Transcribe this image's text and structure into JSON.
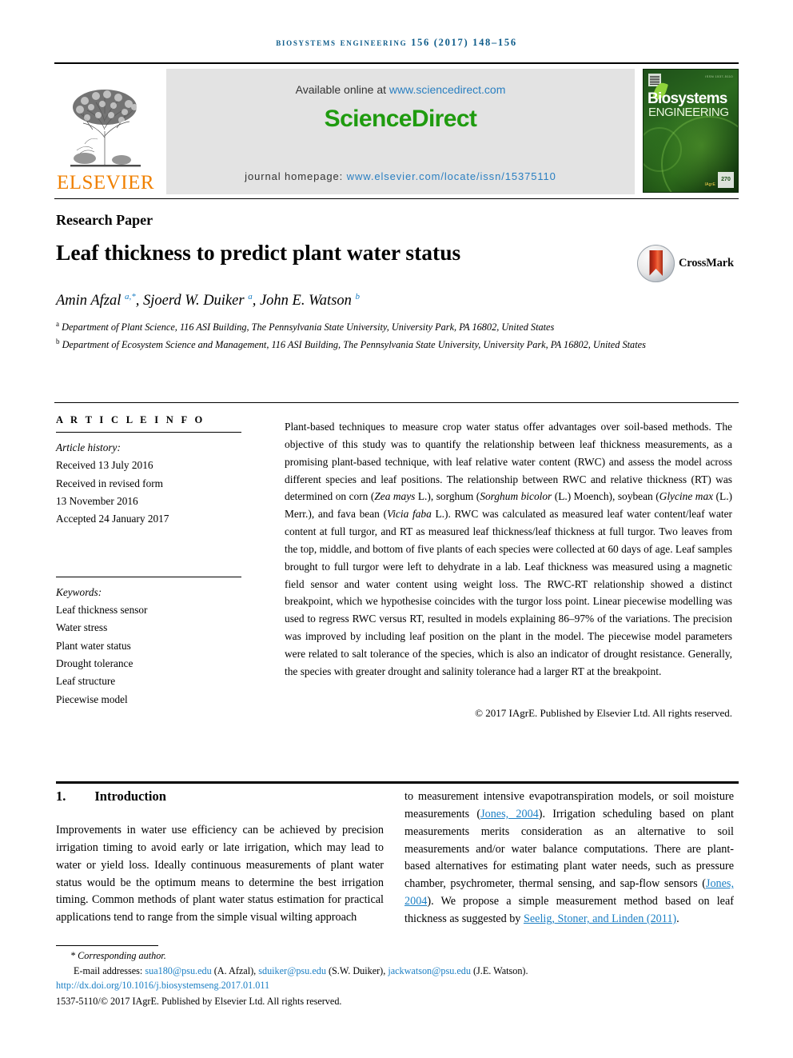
{
  "running_head": "Biosystems Engineering 156 (2017) 148–156",
  "masthead": {
    "elsevier_wordmark": "ELSEVIER",
    "available_prefix": "Available online at ",
    "available_url": "www.sciencedirect.com",
    "sciencedirect_logo": "ScienceDirect",
    "homepage_prefix": "journal homepage: ",
    "homepage_url": "www.elsevier.com/locate/issn/15375110",
    "cover": {
      "title_line1": "Biosystems",
      "title_line2": "ENGINEERING",
      "top_text": "ISSN 1537-5110",
      "badge": "270",
      "badge_sub": "IAgrE"
    },
    "colors": {
      "elsevier_orange": "#F08000",
      "sciencedirect_green": "#1f9b0f",
      "link_blue": "#2a7fc1",
      "banner_grey": "#e3e3e3",
      "cover_green": "#1d4f19"
    }
  },
  "article": {
    "type": "Research Paper",
    "title": "Leaf thickness to predict plant water status",
    "crossmark_label": "CrossMark",
    "authors_html": "Amin Afzal <sup>a,*</sup>, Sjoerd W. Duiker <sup>a</sup>, John E. Watson <sup>b</sup>",
    "affiliations": [
      "a Department of Plant Science, 116 ASI Building, The Pennsylvania State University, University Park, PA 16802, United States",
      "b Department of Ecosystem Science and Management, 116 ASI Building, The Pennsylvania State University, University Park, PA 16802, United States"
    ]
  },
  "article_info": {
    "heading": "A R T I C L E   I N F O",
    "history_label": "Article history:",
    "history": [
      "Received 13 July 2016",
      "Received in revised form",
      "13 November 2016",
      "Accepted 24 January 2017"
    ],
    "keywords_label": "Keywords:",
    "keywords": [
      "Leaf thickness sensor",
      "Water stress",
      "Plant water status",
      "Drought tolerance",
      "Leaf structure",
      "Piecewise model"
    ]
  },
  "abstract": {
    "text": "Plant-based techniques to measure crop water status offer advantages over soil-based methods. The objective of this study was to quantify the relationship between leaf thickness measurements, as a promising plant-based technique, with leaf relative water content (RWC) and assess the model across different species and leaf positions. The relationship between RWC and relative thickness (RT) was determined on corn (Zea mays L.), sorghum (Sorghum bicolor (L.) Moench), soybean (Glycine max (L.) Merr.), and fava bean (Vicia faba L.). RWC was calculated as measured leaf water content/leaf water content at full turgor, and RT as measured leaf thickness/leaf thickness at full turgor. Two leaves from the top, middle, and bottom of five plants of each species were collected at 60 days of age. Leaf samples brought to full turgor were left to dehydrate in a lab. Leaf thickness was measured using a magnetic field sensor and water content using weight loss. The RWC-RT relationship showed a distinct breakpoint, which we hypothesise coincides with the turgor loss point. Linear piecewise modelling was used to regress RWC versus RT, resulted in models explaining 86–97% of the variations. The precision was improved by including leaf position on the plant in the model. The piecewise model parameters were related to salt tolerance of the species, which is also an indicator of drought resistance. Generally, the species with greater drought and salinity tolerance had a larger RT at the breakpoint.",
    "copyright": "© 2017 IAgrE. Published by Elsevier Ltd. All rights reserved."
  },
  "body": {
    "section_number": "1.",
    "section_title": "Introduction",
    "left_paragraph": "Improvements in water use efficiency can be achieved by precision irrigation timing to avoid early or late irrigation, which may lead to water or yield loss. Ideally continuous measurements of plant water status would be the optimum means to determine the best irrigation timing. Common methods of plant water status estimation for practical applications tend to range from the simple visual wilting approach",
    "right_paragraph_parts": {
      "p1": "to measurement intensive evapotranspiration models, or soil moisture measurements (",
      "ref1": "Jones, 2004",
      "p2": "). Irrigation scheduling based on plant measurements merits consideration as an alternative to soil measurements and/or water balance computations. There are plant-based alternatives for estimating plant water needs, such as pressure chamber, psychrometer, thermal sensing, and sap-flow sensors (",
      "ref2": "Jones, 2004",
      "p3": "). We propose a simple measurement method based on leaf thickness as suggested by ",
      "ref3": "Seelig, Stoner, and Linden (2011)",
      "p4": "."
    }
  },
  "footer": {
    "corresponding": "* Corresponding author.",
    "email_label": "E-mail addresses: ",
    "emails": [
      {
        "address": "sua180@psu.edu",
        "name": " (A. Afzal), "
      },
      {
        "address": "sduiker@psu.edu",
        "name": " (S.W. Duiker), "
      },
      {
        "address": "jackwatson@psu.edu",
        "name": " (J.E. Watson)."
      }
    ],
    "doi": "http://dx.doi.org/10.1016/j.biosystemseng.2017.01.011",
    "issn_line": "1537-5110/© 2017 IAgrE. Published by Elsevier Ltd. All rights reserved."
  }
}
